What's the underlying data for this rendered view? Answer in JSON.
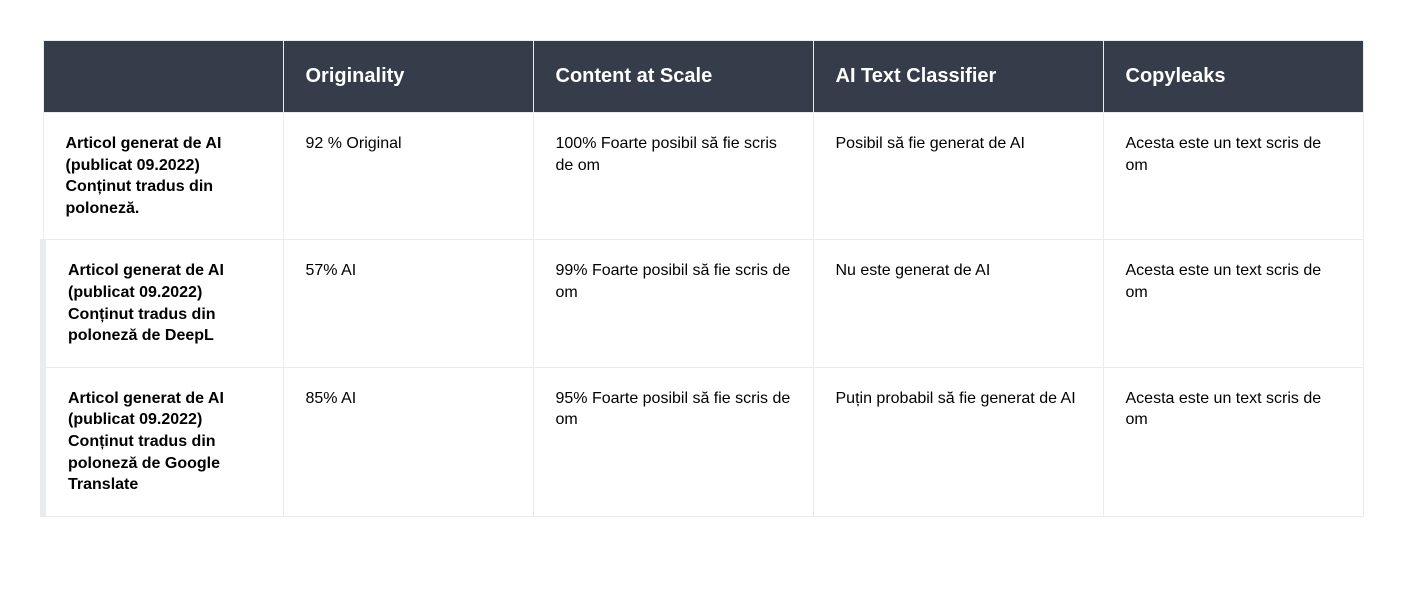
{
  "table": {
    "columns": [
      "",
      "Originality",
      "Content at Scale",
      "AI Text Classifier",
      "Copyleaks"
    ],
    "rows": [
      {
        "label": "Articol generat de AI (publicat 09.2022) Conținut tradus din poloneză.",
        "cells": [
          "92 % Original",
          "100% Foarte posibil să fie scris de om",
          "Posibil să fie generat de AI",
          "Acesta este un text scris de om"
        ]
      },
      {
        "label": "Articol generat de AI (publicat 09.2022) Conținut tradus din poloneză de DeepL",
        "cells": [
          "57% AI",
          "99% Foarte posibil să fie scris de om",
          "Nu este generat de AI",
          "Acesta este un text scris de om"
        ]
      },
      {
        "label": "Articol generat de AI (publicat 09.2022) Conținut tradus din poloneză de Google Translate",
        "cells": [
          "85% AI",
          "95% Foarte posibil să fie scris de om",
          "Puțin probabil să fie generat de AI",
          "Acesta este un text scris de om"
        ]
      }
    ]
  }
}
